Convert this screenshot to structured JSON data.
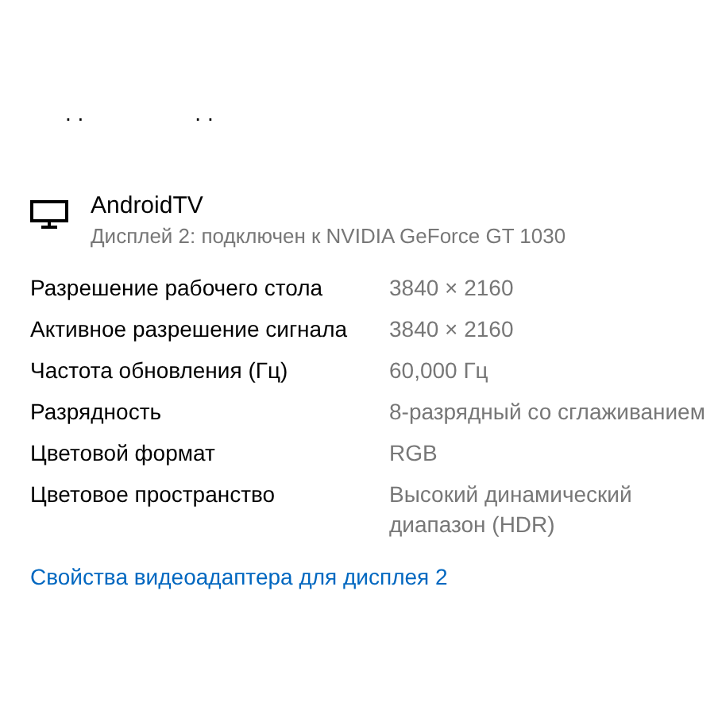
{
  "top_marks": [
    ". .",
    ". ."
  ],
  "display": {
    "name": "AndroidTV",
    "subtitle": "Дисплей 2: подключен к NVIDIA GeForce GT 1030"
  },
  "properties": [
    {
      "label": "Разрешение рабочего стола",
      "value": "3840 × 2160"
    },
    {
      "label": "Активное разрешение сигнала",
      "value": "3840 × 2160"
    },
    {
      "label": "Частота обновления (Гц)",
      "value": "60,000 Гц"
    },
    {
      "label": "Разрядность",
      "value": "8-разрядный со сглаживанием"
    },
    {
      "label": "Цветовой формат",
      "value": "RGB"
    },
    {
      "label": "Цветовое пространство",
      "value": "Высокий динамический диапазон (HDR)"
    }
  ],
  "link": "Свойства видеоадаптера для дисплея 2"
}
